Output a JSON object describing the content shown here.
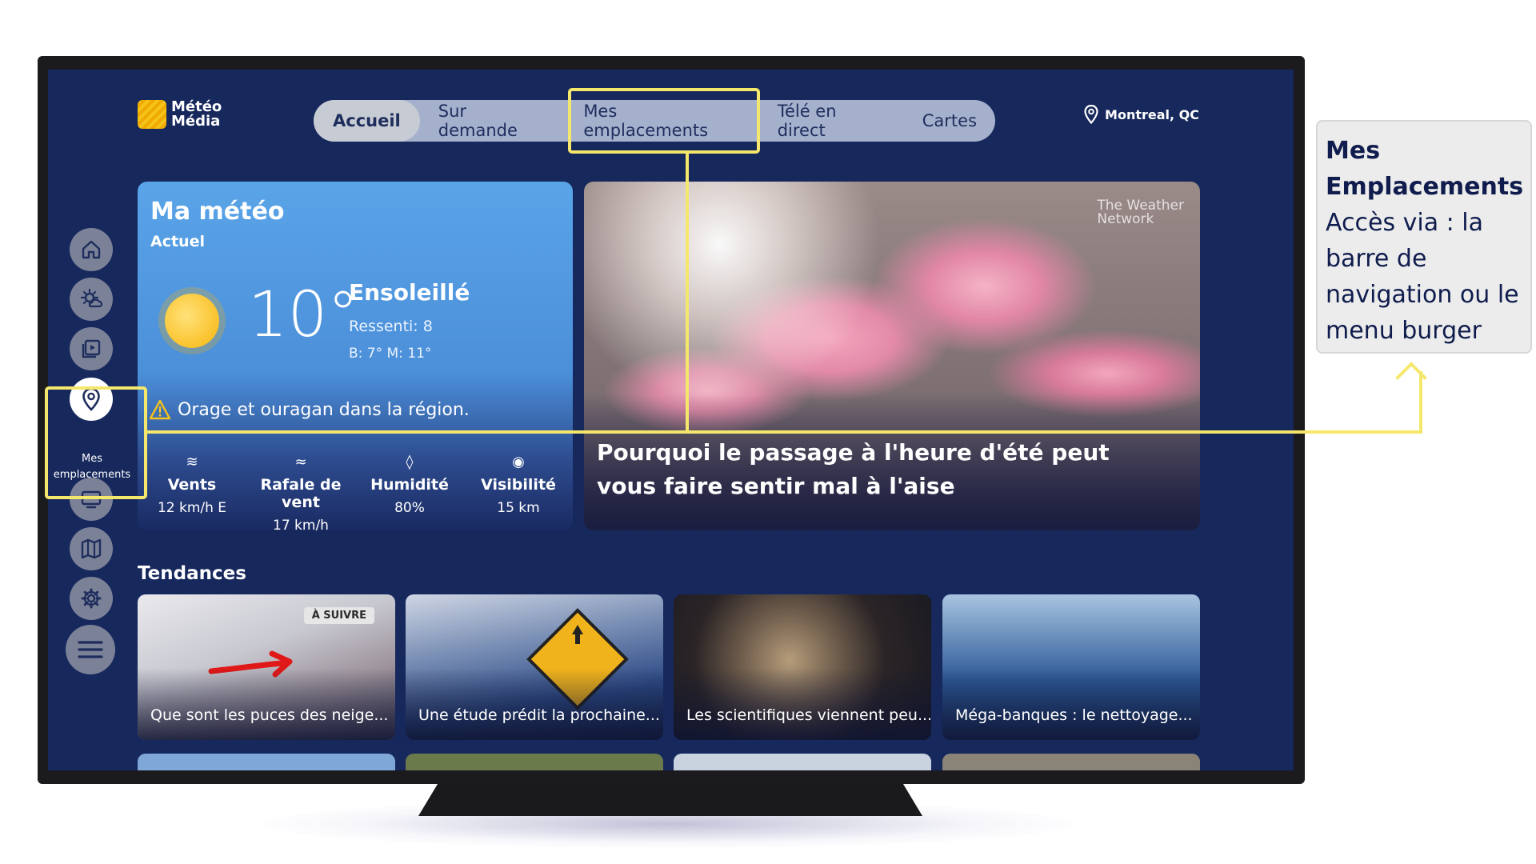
{
  "header": {
    "logo_line1": "Météo",
    "logo_line2": "Média",
    "location": "Montreal, QC"
  },
  "nav": {
    "tabs": [
      {
        "label": "Accueil",
        "active": true
      },
      {
        "label": "Sur demande",
        "active": false
      },
      {
        "label": "Mes emplacements",
        "active": false
      },
      {
        "label": "Télé en direct",
        "active": false
      },
      {
        "label": "Cartes",
        "active": false
      }
    ]
  },
  "sidebar": {
    "items": [
      {
        "icon": "home-icon"
      },
      {
        "icon": "weather-icon"
      },
      {
        "icon": "video-icon"
      },
      {
        "icon": "location-pin-icon",
        "label": "Mes emplacements",
        "active": true
      },
      {
        "icon": "tv-icon"
      },
      {
        "icon": "map-icon"
      },
      {
        "icon": "gear-icon"
      },
      {
        "icon": "menu-icon"
      }
    ]
  },
  "weather": {
    "title": "Ma météo",
    "subtitle": "Actuel",
    "temperature": "10°",
    "condition": "Ensoleillé",
    "feels_like": "Ressenti:  8",
    "hi_lo": "B:  7°   M:  11°",
    "alert": "Orage et ouragan dans la région.",
    "stats": [
      {
        "icon": "wind-icon",
        "label": "Vents",
        "value": "12 km/h E"
      },
      {
        "icon": "gust-icon",
        "label": "Rafale de vent",
        "value": "17 km/h"
      },
      {
        "icon": "humidity-icon",
        "label": "Humidité",
        "value": "80%"
      },
      {
        "icon": "visibility-icon",
        "label": "Visibilité",
        "value": "15 km"
      }
    ]
  },
  "hero": {
    "title": "Pourquoi le passage à l'heure d'été peut vous faire sentir mal à l'aise",
    "watermark_line1": "The Weather",
    "watermark_line2": "Network"
  },
  "trends": {
    "title": "Tendances",
    "items": [
      {
        "caption": "Que sont les puces des neige...",
        "badge": "À SUIVRE"
      },
      {
        "caption": "Une étude prédit la prochaine..."
      },
      {
        "caption": "Les scientifiques viennent peu..."
      },
      {
        "caption": "Méga-banques : le nettoyage..."
      }
    ]
  },
  "annotation": {
    "title_line1": "Mes",
    "title_line2": "Emplacements",
    "text": "Accès via : la barre de navigation ou le menu burger"
  },
  "colors": {
    "screen_bg": "#16285c",
    "highlight": "#f4e76c",
    "annotation_text": "#0f1c4d"
  }
}
